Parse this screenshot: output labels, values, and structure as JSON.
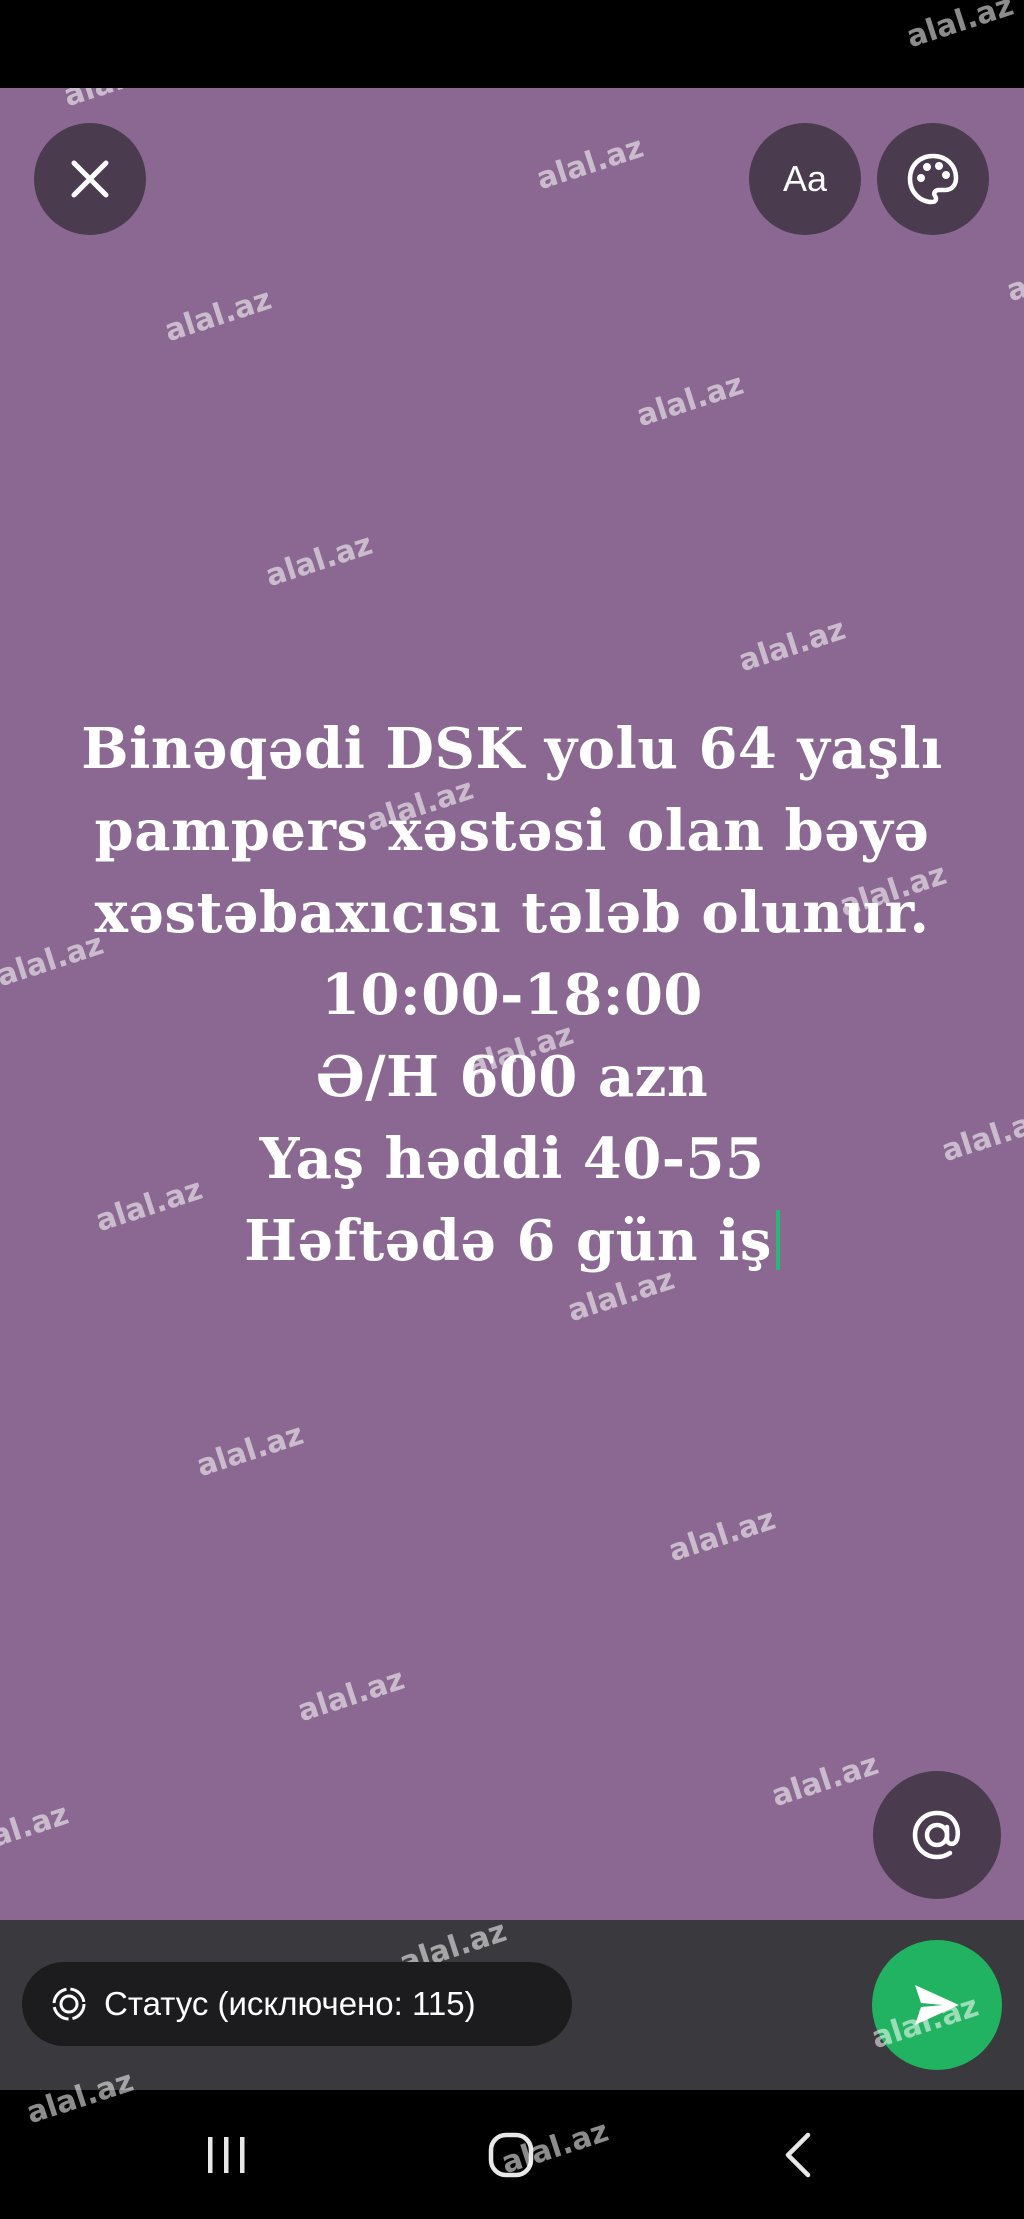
{
  "watermark": "alal.az",
  "toolbar": {
    "font_button_label": "Aa"
  },
  "status_text": {
    "lines": [
      "Binəqədi DSK yolu 64 yaşlı",
      "pampers xəstəsi olan bəyə",
      "xəstəbaxıcısı tələb olunur.",
      "10:00-18:00",
      "Ə/H 600 azn",
      "Yaş həddi 40-55",
      "Həftədə 6 gün iş"
    ]
  },
  "bottom": {
    "audience_label": "Статус (исключено: 115)"
  },
  "colors": {
    "background": "#8a6891",
    "button": "#4a3b4e",
    "send": "#21b361",
    "cursor": "#2bb673"
  },
  "icons": {
    "close": "close-icon",
    "palette": "palette-icon",
    "mention": "at-sign-icon",
    "audience": "status-icon",
    "send": "send-icon"
  }
}
